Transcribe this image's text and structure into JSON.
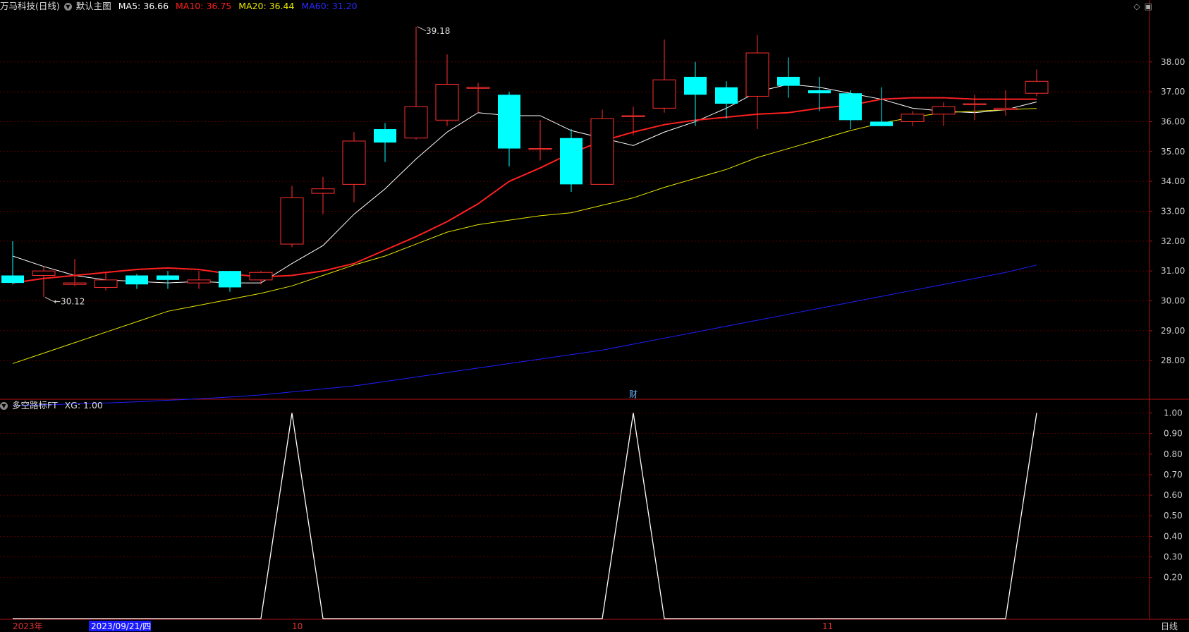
{
  "header": {
    "stock": "万马科技(日线)",
    "template": "默认主图",
    "ma5": "MA5: 36.66",
    "ma10": "MA10: 36.75",
    "ma20": "MA20: 36.44",
    "ma60": "MA60: 31.20",
    "colors": {
      "ma5": "#ffffff",
      "ma10": "#ff2020",
      "ma20": "#e8e800",
      "ma60": "#1e1eff"
    }
  },
  "icons": {
    "diamond": "diamond-icon",
    "window": "window-icon"
  },
  "sub_header": {
    "indicator": "多空路标FT",
    "value": "XG: 1.00"
  },
  "fin_badge": "财",
  "footer": {
    "year": "2023年",
    "cursor_date": "2023/09/21/四",
    "oct": "10",
    "nov": "11",
    "period": "日线"
  },
  "chart_data": [
    {
      "type": "candlestick",
      "title": "万马科技(日线)",
      "ylim": [
        26.8,
        39.6
      ],
      "y_ticks": [
        "38.00",
        "37.00",
        "36.00",
        "35.00",
        "34.00",
        "33.00",
        "32.00",
        "31.00",
        "30.00",
        "29.00",
        "28.00"
      ],
      "candles": [
        {
          "o": 30.85,
          "h": 32.0,
          "l": 30.55,
          "c": 30.6
        },
        {
          "o": 30.85,
          "h": 31.15,
          "l": 30.12,
          "c": 31.0
        },
        {
          "o": 30.55,
          "h": 31.4,
          "l": 30.5,
          "c": 30.6
        },
        {
          "o": 30.45,
          "h": 30.95,
          "l": 30.35,
          "c": 30.7
        },
        {
          "o": 30.85,
          "h": 30.9,
          "l": 30.4,
          "c": 30.55
        },
        {
          "o": 30.85,
          "h": 31.0,
          "l": 30.4,
          "c": 30.7
        },
        {
          "o": 30.6,
          "h": 31.0,
          "l": 30.4,
          "c": 30.7
        },
        {
          "o": 31.0,
          "h": 31.0,
          "l": 30.3,
          "c": 30.45
        },
        {
          "o": 30.7,
          "h": 31.0,
          "l": 30.55,
          "c": 30.95
        },
        {
          "o": 31.9,
          "h": 33.85,
          "l": 31.8,
          "c": 33.45
        },
        {
          "o": 33.6,
          "h": 34.15,
          "l": 32.9,
          "c": 33.75
        },
        {
          "o": 33.9,
          "h": 35.65,
          "l": 33.3,
          "c": 35.35
        },
        {
          "o": 35.75,
          "h": 35.95,
          "l": 34.65,
          "c": 35.3
        },
        {
          "o": 35.45,
          "h": 39.18,
          "l": 35.4,
          "c": 36.5
        },
        {
          "o": 36.05,
          "h": 38.25,
          "l": 35.85,
          "c": 37.25
        },
        {
          "o": 37.15,
          "h": 37.3,
          "l": 36.3,
          "c": 37.15
        },
        {
          "o": 36.9,
          "h": 37.0,
          "l": 34.5,
          "c": 35.1
        },
        {
          "o": 35.1,
          "h": 36.05,
          "l": 34.7,
          "c": 35.1
        },
        {
          "o": 35.45,
          "h": 35.75,
          "l": 33.65,
          "c": 33.9
        },
        {
          "o": 33.9,
          "h": 36.4,
          "l": 33.9,
          "c": 36.1
        },
        {
          "o": 36.2,
          "h": 36.5,
          "l": 35.55,
          "c": 36.2
        },
        {
          "o": 36.45,
          "h": 38.75,
          "l": 36.3,
          "c": 37.4
        },
        {
          "o": 37.5,
          "h": 38.0,
          "l": 35.85,
          "c": 36.9
        },
        {
          "o": 37.15,
          "h": 37.35,
          "l": 36.1,
          "c": 36.6
        },
        {
          "o": 36.85,
          "h": 38.9,
          "l": 35.75,
          "c": 38.3
        },
        {
          "o": 37.5,
          "h": 38.15,
          "l": 36.8,
          "c": 37.2
        },
        {
          "o": 37.05,
          "h": 37.5,
          "l": 36.35,
          "c": 36.95
        },
        {
          "o": 36.95,
          "h": 37.05,
          "l": 35.75,
          "c": 36.05
        },
        {
          "o": 36.0,
          "h": 37.15,
          "l": 35.85,
          "c": 35.85
        },
        {
          "o": 36.0,
          "h": 36.35,
          "l": 35.85,
          "c": 36.25
        },
        {
          "o": 36.25,
          "h": 36.65,
          "l": 35.85,
          "c": 36.5
        },
        {
          "o": 36.6,
          "h": 36.9,
          "l": 36.05,
          "c": 36.6
        },
        {
          "o": 36.4,
          "h": 37.05,
          "l": 36.2,
          "c": 36.45
        },
        {
          "o": 36.95,
          "h": 37.75,
          "l": 36.85,
          "c": 37.35
        }
      ],
      "annotations": [
        {
          "label": "39.18",
          "index": 13,
          "value": 39.18,
          "side": "right"
        },
        {
          "label": "30.12",
          "index": 1,
          "value": 30.12,
          "side": "right"
        }
      ],
      "series": [
        {
          "name": "MA5",
          "color": "#ffffff",
          "values": [
            31.5,
            31.15,
            30.85,
            30.7,
            30.65,
            30.6,
            30.65,
            30.6,
            30.6,
            31.25,
            31.85,
            32.9,
            33.75,
            34.75,
            35.65,
            36.3,
            36.2,
            36.2,
            35.7,
            35.45,
            35.2,
            35.65,
            36.0,
            36.45,
            37.0,
            37.25,
            37.15,
            36.95,
            36.75,
            36.45,
            36.35,
            36.3,
            36.4,
            36.66
          ]
        },
        {
          "name": "MA10",
          "color": "#ff2020",
          "values": [
            30.6,
            30.75,
            30.85,
            30.95,
            31.05,
            31.1,
            31.05,
            30.9,
            30.8,
            30.85,
            31.0,
            31.25,
            31.7,
            32.15,
            32.65,
            33.25,
            34.0,
            34.45,
            34.95,
            35.35,
            35.65,
            35.9,
            36.05,
            36.15,
            36.25,
            36.3,
            36.45,
            36.55,
            36.75,
            36.8,
            36.8,
            36.75,
            36.75,
            36.75
          ]
        },
        {
          "name": "MA20",
          "color": "#e8e800",
          "values": [
            27.9,
            28.25,
            28.6,
            28.95,
            29.3,
            29.65,
            29.85,
            30.05,
            30.25,
            30.5,
            30.85,
            31.2,
            31.5,
            31.9,
            32.3,
            32.55,
            32.7,
            32.85,
            32.95,
            33.2,
            33.45,
            33.8,
            34.1,
            34.4,
            34.8,
            35.1,
            35.4,
            35.7,
            35.95,
            36.15,
            36.3,
            36.35,
            36.4,
            36.44
          ]
        },
        {
          "name": "MA60",
          "color": "#1e1eff",
          "values": [
            26.5,
            26.52,
            26.55,
            26.58,
            26.62,
            26.67,
            26.72,
            26.78,
            26.85,
            26.95,
            27.05,
            27.15,
            27.3,
            27.45,
            27.6,
            27.75,
            27.9,
            28.05,
            28.2,
            28.35,
            28.55,
            28.75,
            28.95,
            29.15,
            29.35,
            29.55,
            29.75,
            29.95,
            30.15,
            30.35,
            30.55,
            30.75,
            30.95,
            31.2
          ]
        }
      ]
    },
    {
      "type": "line",
      "title": "多空路标FT",
      "ylim": [
        0,
        1.06
      ],
      "y_ticks": [
        "1.00",
        "0.90",
        "0.80",
        "0.70",
        "0.60",
        "0.50",
        "0.40",
        "0.30",
        "0.20"
      ],
      "series": [
        {
          "name": "XG",
          "color": "#ffffff",
          "values": [
            0,
            0,
            0,
            0,
            0,
            0,
            0,
            0,
            0,
            1,
            0,
            0,
            0,
            0,
            0,
            0,
            0,
            0,
            0,
            0,
            1,
            0,
            0,
            0,
            0,
            0,
            0,
            0,
            0,
            0,
            0,
            0,
            0,
            1
          ]
        }
      ]
    }
  ]
}
